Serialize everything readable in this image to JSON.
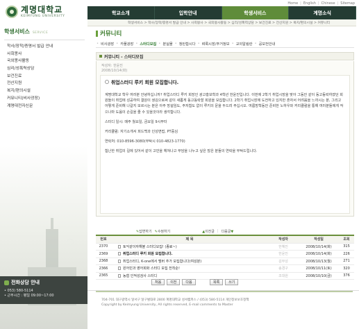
{
  "header": {
    "logo": {
      "korean": "계명대학교",
      "english": "KEIMYUNG UNIVERSITY"
    },
    "toplinks": [
      "Home",
      "English",
      "Chinese",
      "Sitemap"
    ],
    "gnb": [
      {
        "label": "학교소개",
        "active": false
      },
      {
        "label": "입학안내",
        "active": false
      },
      {
        "label": "학생서비스",
        "active": true
      },
      {
        "label": "계명소식",
        "active": false
      }
    ],
    "breadcrumb": "학생서비스 > 학사/장학/증명서 발급 안내 > 사회봉사 > 국외봉사활동 > 심리/성폭력상담 > 보건진료 > 전산지원 > 복지/편의시설 > 커뮤니티"
  },
  "sidebar": {
    "title": "학생서비스",
    "title_en": "SERVICE",
    "items": [
      "학사/장학/증명서 발급 안내",
      "사회봉사",
      "국외봉사활동",
      "심리/성폭력상담",
      "보건진료",
      "전산지원",
      "복지/편의시설",
      "커뮤니티(비사광장)",
      "계명대전자신문"
    ],
    "consult": {
      "title": "전화상담 안내",
      "phone": "• 053) 580-5114",
      "hours": "• 근무시간 : 평일 09:00~17:00"
    }
  },
  "main": {
    "page_title": "커뮤니티",
    "tabs": [
      {
        "label": "비사광장",
        "active": false
      },
      {
        "label": "카풀광장",
        "active": false
      },
      {
        "label": "스터디모집",
        "active": true
      },
      {
        "label": "분실물",
        "active": false
      },
      {
        "label": "청탄합시다",
        "active": false
      },
      {
        "label": "벼룩시장/주거정보",
        "active": false
      },
      {
        "label": "교외알림란",
        "active": false
      },
      {
        "label": "공모전안내",
        "active": false
      }
    ],
    "board_name": "커뮤니티 - 스터디모집",
    "post": {
      "meta_author": "작성자: 한윤진",
      "meta_date": "2008/10/14(화)",
      "title": "취업스터디 루키 회원 모집합니다.",
      "para1": "계명대학교 학우 여러분 안녕하십니까? 취업스터디 루키 회장인 광고홍보학과 4학년 한윤진입니다. 이번에 2학기 취업시장을 맞아 그동안 같이 동고동락하였던 회원들이 취업에 성공하여 결원이 생김으로써 같이 새롭게 동고동락할 회원을 모집합니다. 2학기 취업시장에 도전하고 있지만 혼자서 어려움을 느끼시는 분, 그리고 어떻게 준비해 나갈지 모르시는 분은 아주 망설임도, 주저함도 없이 루키의 문을 두드려 주십시오. 여름방학동안 준비한 노하우와 커리큘럼을 통해 여러분들에게 작으나마 도움이 손길을 줄 수 있을것이라 생각합니다.",
      "para2": "스터디 일시: 매주 월요일, 금요일 9시부터",
      "para3": "커리큘럼: 자기소개서 피드백과 인성면접, PT중심",
      "para4": "연락처: 010-8596-3080(부탁시 010-4823-1770)",
      "para5": "험난한 취업의 길에 있어서 같이 고민을 헤쳐나고 부담을 나누고 싶은 많은 분들의 연락을 부탁드립니다."
    },
    "actions": {
      "reply": "답변하기",
      "edit": "수정하기",
      "prev": "이전글",
      "next": "다음글"
    },
    "table": {
      "headers": {
        "no": "번호",
        "title": "제 목",
        "author": "작성자",
        "date": "작성일",
        "views": "조회"
      },
      "rows": [
        {
          "no": "2370",
          "title": "토익같이자해볼 스터디모집! (종료~)",
          "author": "한혜진",
          "date": "2008/10/14(화)",
          "views": "315",
          "current": false
        },
        {
          "no": "2369",
          "title": "취업스터디 루키 회원 모집합니다.",
          "author": "한윤진",
          "date": "2008/10/14(화)",
          "views": "226",
          "current": true
        },
        {
          "no": "2368",
          "title": "취업스터디, K-one에서 멤버 추가 모집합니다(여성분)",
          "author": "김무성",
          "date": "2008/10/13(월)",
          "views": "271",
          "current": false
        },
        {
          "no": "2366",
          "title": "원어민과 영어회화 스터디 모집 전착순!",
          "author": "송경구",
          "date": "2008/10/11(토)",
          "views": "320",
          "current": false
        },
        {
          "no": "2365",
          "title": "농협 인적성검사 스터디",
          "author": "조대원",
          "date": "2008/10/10(금)",
          "views": "376",
          "current": false
        }
      ]
    },
    "pager": [
      "처음",
      "이전",
      "다음"
    ],
    "list_buttons": [
      "목록",
      "쓰기"
    ]
  },
  "footer": {
    "line1": "704-701 대구광역시 달서구 달구벌대로 2800 계명대학교 성서캠퍼스 / (053) 580-5114 개인정보보호정책",
    "line2": "Copyright by Keimyung University, All rights reserved, E-mail comments to Master"
  }
}
